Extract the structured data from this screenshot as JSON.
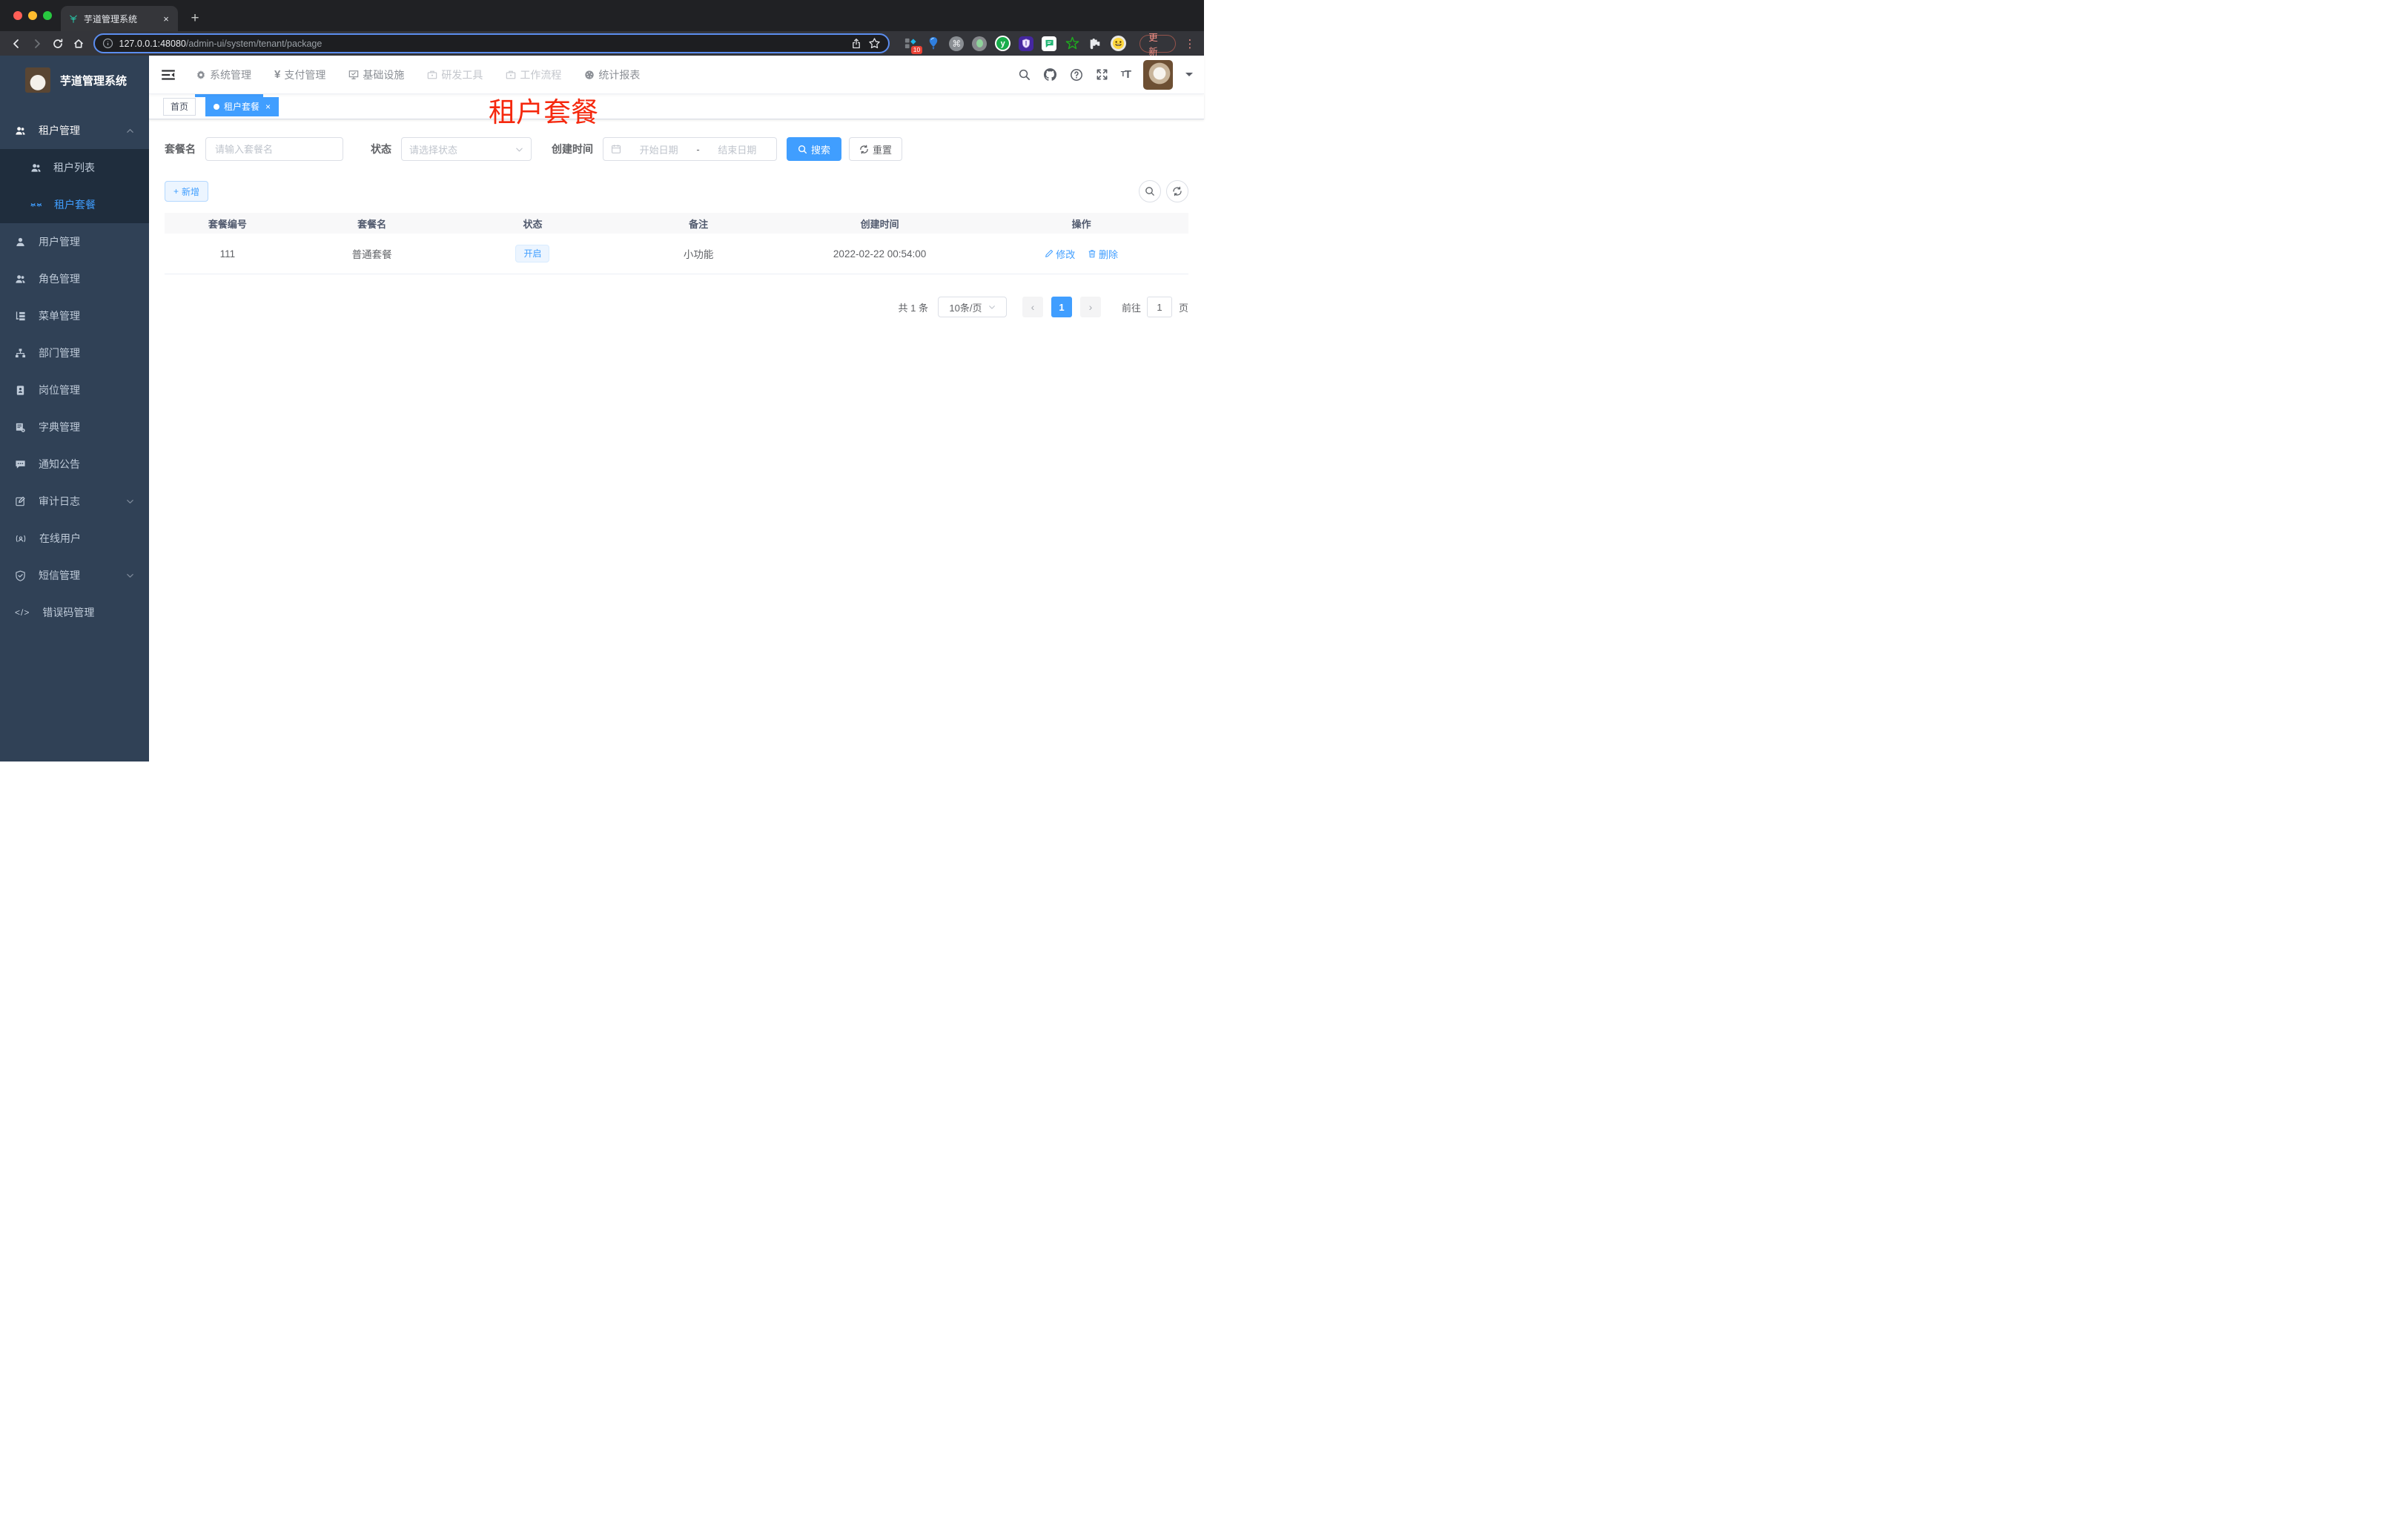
{
  "glyphs": {
    "close": "×",
    "plus": "+",
    "prev": "‹",
    "next": "›",
    "dots": "⋮",
    "yen": "¥",
    "question": "?",
    "t_big": "T",
    "t_small": "T",
    "code": "</>",
    "ext_y": "y",
    "command": "⌘"
  },
  "browser": {
    "tab_title": "芋道管理系统",
    "url_host": "127.0.0.1:48080",
    "url_path": "/admin-ui/system/tenant/package",
    "extension_badge": "10",
    "update_button": "更新"
  },
  "logo": {
    "title": "芋道管理系统"
  },
  "top_nav": {
    "items": [
      {
        "label": "系统管理"
      },
      {
        "label": "支付管理"
      },
      {
        "label": "基础设施"
      },
      {
        "label": "研发工具"
      },
      {
        "label": "工作流程"
      },
      {
        "label": "统计报表"
      }
    ]
  },
  "sidebar": {
    "parent": {
      "label": "租户管理"
    },
    "children": [
      {
        "label": "租户列表"
      },
      {
        "label": "租户套餐"
      }
    ],
    "items": [
      {
        "label": "用户管理"
      },
      {
        "label": "角色管理"
      },
      {
        "label": "菜单管理"
      },
      {
        "label": "部门管理"
      },
      {
        "label": "岗位管理"
      },
      {
        "label": "字典管理"
      },
      {
        "label": "通知公告"
      },
      {
        "label": "审计日志"
      },
      {
        "label": "在线用户"
      },
      {
        "label": "短信管理"
      },
      {
        "label": "错误码管理"
      }
    ]
  },
  "tags": {
    "home": "首页",
    "active": "租户套餐"
  },
  "watermark": "租户套餐",
  "filters": {
    "name_label": "套餐名",
    "name_placeholder": "请输入套餐名",
    "status_label": "状态",
    "status_placeholder": "请选择状态",
    "date_label": "创建时间",
    "date_start": "开始日期",
    "date_sep": "-",
    "date_end": "结束日期",
    "search": "搜索",
    "reset": "重置"
  },
  "toolbar": {
    "add": "新增"
  },
  "table": {
    "headers": [
      "套餐编号",
      "套餐名",
      "状态",
      "备注",
      "创建时间",
      "操作"
    ],
    "rows": [
      {
        "id": "111",
        "name": "普通套餐",
        "status": "开启",
        "remark": "小功能",
        "created": "2022-02-22 00:54:00"
      }
    ],
    "actions": {
      "edit": "修改",
      "delete": "删除"
    }
  },
  "pagination": {
    "total": "共 1 条",
    "page_size": "10条/页",
    "page": "1",
    "goto_label": "前往",
    "goto_value": "1",
    "unit": "页"
  },
  "colors": {
    "accent": "#409eff",
    "watermark_red": "#f5280e"
  }
}
